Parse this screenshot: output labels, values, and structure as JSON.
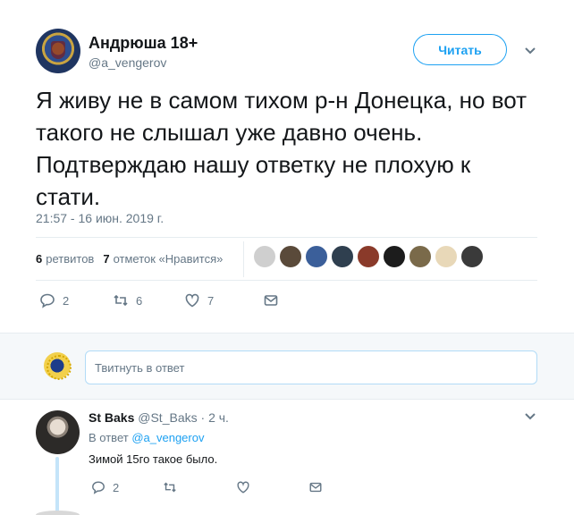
{
  "author": {
    "name": "Андрюша 18+",
    "handle": "@a_vengerov",
    "follow_label": "Читать"
  },
  "tweet": {
    "text": "Я живу не в самом тихом р-н Донецка, но вот такого не слышал уже давно очень. Подтверждаю нашу ответку не плохую к стати.",
    "timestamp": "21:57 - 16 июн. 2019 г.",
    "retweets_count": "6",
    "retweets_label": "ретвитов",
    "likes_count": "7",
    "likes_label": "отметок «Нравится»",
    "replies": "2",
    "retweets": "6",
    "likes": "7"
  },
  "liker_colors": [
    "#cfcfcf",
    "#5a4a3a",
    "#3b5f9a",
    "#2f3f4f",
    "#8a3a2a",
    "#1c1c1c",
    "#7a6a4a",
    "#e8d8b8",
    "#3a3a3a"
  ],
  "reply_box": {
    "placeholder": "Твитнуть в ответ"
  },
  "reply": {
    "name": "St Baks",
    "handle": "@St_Baks",
    "time": "2 ч.",
    "in_reply_prefix": "В ответ",
    "in_reply_to": "@a_vengerov",
    "text": "Зимой 15го такое было.",
    "replies": "2"
  }
}
